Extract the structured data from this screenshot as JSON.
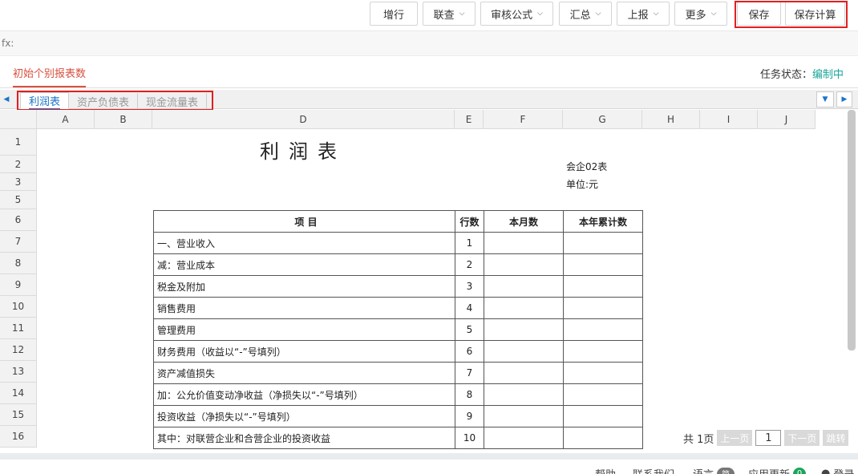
{
  "toolbar": {
    "buttons": [
      {
        "label": "增行",
        "dropdown": false
      },
      {
        "label": "联查",
        "dropdown": true
      },
      {
        "label": "审核公式",
        "dropdown": true
      },
      {
        "label": "汇总",
        "dropdown": true
      },
      {
        "label": "上报",
        "dropdown": true
      },
      {
        "label": "更多",
        "dropdown": true
      },
      {
        "label": "保存",
        "dropdown": false
      },
      {
        "label": "保存计算",
        "dropdown": false
      }
    ],
    "chevron": "⌄"
  },
  "fx": {
    "label": "fx:"
  },
  "header": {
    "tab": "初始个别报表数",
    "status_label": "任务状态：",
    "status_value": "编制中"
  },
  "sheet_tabs": [
    "利润表",
    "资产负债表",
    "现金流量表"
  ],
  "columns": [
    "A",
    "B",
    "D",
    "E",
    "F",
    "G",
    "H",
    "I",
    "J"
  ],
  "rows": [
    "1",
    "2",
    "3",
    "5",
    "6",
    "7",
    "8",
    "9",
    "10",
    "11",
    "12",
    "13",
    "14",
    "15",
    "16"
  ],
  "report": {
    "title": "利润表",
    "form_no": "会企02表",
    "unit": "单位:元",
    "headers": {
      "item": "项 目",
      "line": "行数",
      "month": "本月数",
      "ytd": "本年累计数"
    },
    "items": [
      {
        "item": "一、营业收入",
        "line": "1"
      },
      {
        "item": "减：营业成本",
        "line": "2"
      },
      {
        "item": "税金及附加",
        "line": "3"
      },
      {
        "item": "销售费用",
        "line": "4"
      },
      {
        "item": "管理费用",
        "line": "5"
      },
      {
        "item": "财务费用（收益以“-”号填列）",
        "line": "6"
      },
      {
        "item": "资产减值损失",
        "line": "7"
      },
      {
        "item": "加：公允价值变动净收益（净损失以“-”号填列）",
        "line": "8"
      },
      {
        "item": "投资收益（净损失以“-”号填列）",
        "line": "9"
      },
      {
        "item": "其中：对联营企业和合营企业的投资收益",
        "line": "10"
      }
    ]
  },
  "pager": {
    "total": "共 1页",
    "prev": "上一页",
    "current": "1",
    "next": "下一页",
    "jump": "跳转"
  },
  "footer": {
    "help": "帮助",
    "contact": "联系我们",
    "language": "语言",
    "language_badge": "简",
    "updates": "应用更新",
    "updates_count": "0",
    "login": "登录"
  },
  "colors": {
    "accent_red": "#d9503f",
    "status_teal": "#19a59a",
    "tab_blue": "#1a73c9",
    "highlight": "#e02020"
  }
}
